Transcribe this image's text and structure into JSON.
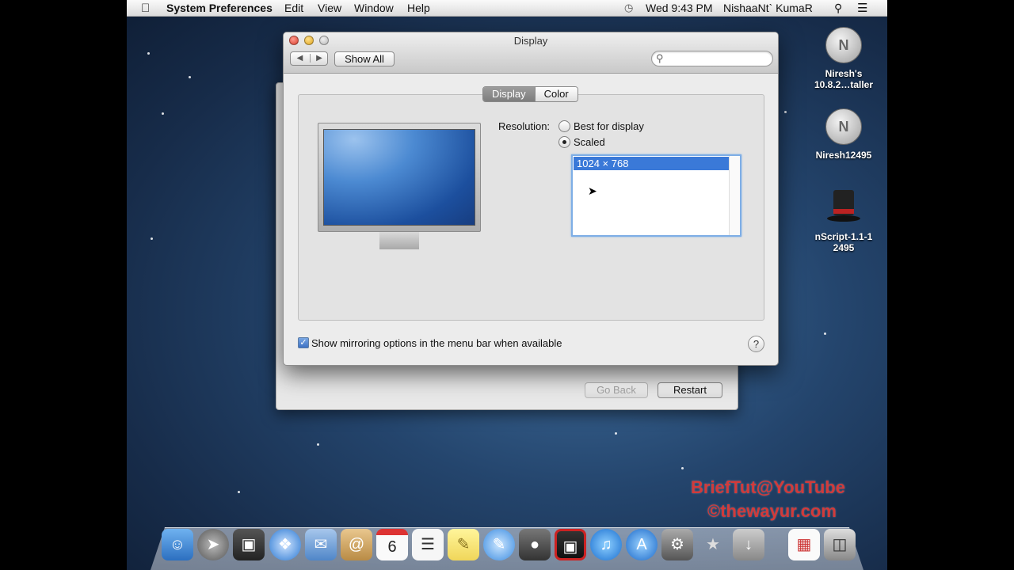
{
  "menubar": {
    "app_name": "System Preferences",
    "menus": [
      "Edit",
      "View",
      "Window",
      "Help"
    ],
    "clock": "Wed 9:43 PM",
    "user": "NishaaNt` KumaR"
  },
  "window": {
    "title": "Display",
    "show_all_label": "Show All",
    "search_placeholder": "",
    "tabs": [
      "Display",
      "Color"
    ],
    "resolution_label": "Resolution:",
    "options": [
      "Best for display",
      "Scaled"
    ],
    "selected_option": "Scaled",
    "resolutions": [
      "1024 × 768"
    ],
    "mirroring_label": "Show mirroring options in the menu bar when available",
    "mirroring_checked": true,
    "help_label": "?"
  },
  "background_window": {
    "go_back_label": "Go Back",
    "restart_label": "Restart"
  },
  "desktop_icons": [
    {
      "label_line1": "Niresh's",
      "label_line2": "10.8.2…taller",
      "glyph": "N"
    },
    {
      "label_line1": "Niresh12495",
      "label_line2": "",
      "glyph": "N"
    },
    {
      "label_line1": "nScript-1.1-1",
      "label_line2": "2495",
      "glyph": ""
    }
  ],
  "watermark": {
    "line1": "BriefTut@YouTube",
    "line2": "©thewayur.com"
  },
  "dock": {
    "calendar_day": "6",
    "app_icons": [
      "finder-icon",
      "launchpad-icon",
      "photo-booth-icon",
      "safari-icon",
      "mail-icon",
      "contacts-icon",
      "calendar-icon",
      "reminders-icon",
      "notes-icon",
      "messages-icon",
      "facetime-icon",
      "photo-icon",
      "itunes-icon",
      "app-store-icon",
      "system-preferences-icon",
      "wizard-icon",
      "downloads-icon",
      "document-icon",
      "trash-icon"
    ]
  },
  "colors": {
    "accent_blue": "#3a79d8",
    "watermark_red": "#d23a3a"
  }
}
